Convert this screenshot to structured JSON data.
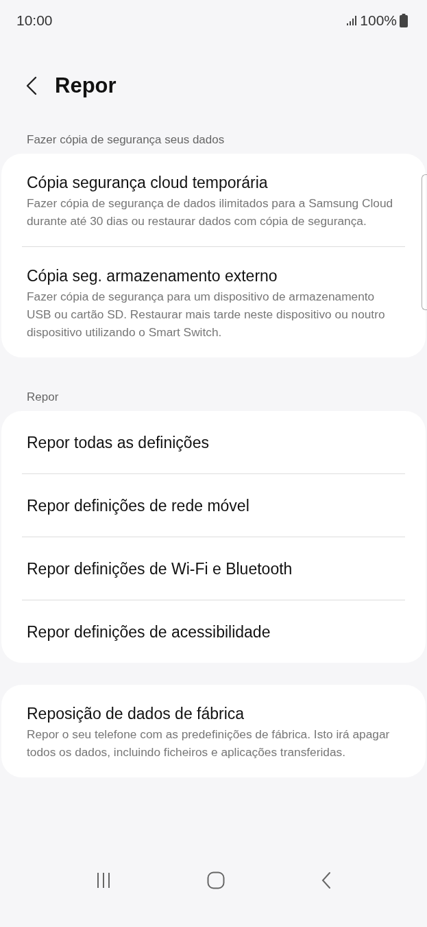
{
  "status_bar": {
    "time": "10:00",
    "battery": "100%"
  },
  "header": {
    "title": "Repor"
  },
  "sections": [
    {
      "heading": "Fazer cópia de segurança seus dados",
      "items": [
        {
          "title": "Cópia segurança cloud temporária",
          "description": "Fazer cópia de segurança de dados ilimitados para a Samsung Cloud durante até 30 dias ou restaurar dados com cópia de segurança."
        },
        {
          "title": "Cópia seg. armazenamento externo",
          "description": "Fazer cópia de segurança para um dispositivo de armazenamento USB ou cartão SD. Restaurar mais tarde neste dispositivo ou noutro dispositivo utilizando o Smart Switch."
        }
      ]
    },
    {
      "heading": "Repor",
      "items": [
        {
          "title": "Repor todas as definições"
        },
        {
          "title": "Repor definições de rede móvel"
        },
        {
          "title": "Repor definições de Wi-Fi e Bluetooth"
        },
        {
          "title": "Repor definições de acessibilidade"
        }
      ]
    },
    {
      "items": [
        {
          "title": "Reposição de dados de fábrica",
          "description": "Repor o seu telefone com as predefinições de fábrica. Isto irá apagar todos os dados, incluindo ficheiros e aplicações transferidas."
        }
      ]
    }
  ]
}
